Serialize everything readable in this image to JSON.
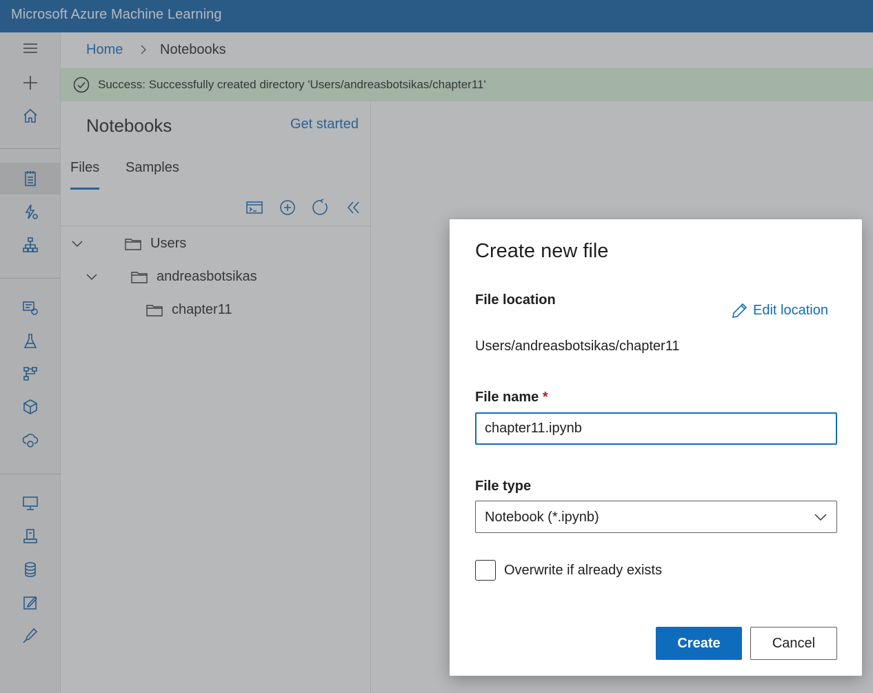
{
  "app": {
    "title": "Microsoft Azure Machine Learning"
  },
  "left_rail": {
    "items": [
      {
        "icon": "hamburger-menu-icon"
      },
      {
        "icon": "plus-icon"
      },
      {
        "icon": "home-icon"
      },
      {
        "icon": "notebook-icon",
        "active": true
      },
      {
        "icon": "automl-lightning-icon"
      },
      {
        "icon": "designer-hierarchy-icon"
      },
      {
        "icon": "datasets-icon"
      },
      {
        "icon": "experiments-flask-icon"
      },
      {
        "icon": "pipelines-icon"
      },
      {
        "icon": "models-cube-icon"
      },
      {
        "icon": "endpoints-cloud-icon"
      },
      {
        "icon": "compute-monitor-icon"
      },
      {
        "icon": "environments-icon"
      },
      {
        "icon": "datastores-cylinder-icon"
      },
      {
        "icon": "data-labeling-edit-icon"
      },
      {
        "icon": "linked-services-icon"
      }
    ]
  },
  "breadcrumb": {
    "home": "Home",
    "current": "Notebooks"
  },
  "message_bar": {
    "status": "Success:",
    "text": "Successfully created directory 'Users/andreasbotsikas/chapter11'"
  },
  "file_pane": {
    "title": "Notebooks",
    "get_started": "Get started",
    "tabs": [
      {
        "label": "Files",
        "active": true
      },
      {
        "label": "Samples",
        "active": false
      }
    ],
    "toolbar_icons": [
      "terminal-icon",
      "add-circle-icon",
      "refresh-icon",
      "collapse-double-chevron-icon"
    ],
    "tree": [
      {
        "label": "Users",
        "level": 0,
        "expanded": true
      },
      {
        "label": "andreasbotsikas",
        "level": 1,
        "expanded": true
      },
      {
        "label": "chapter11",
        "level": 2,
        "expanded": false
      }
    ]
  },
  "dialog": {
    "title": "Create new file",
    "file_location_label": "File location",
    "edit_location_label": "Edit location",
    "file_location_value": "Users/andreasbotsikas/chapter11",
    "file_name_label": "File name",
    "required_marker": "*",
    "file_name_value": "chapter11.ipynb",
    "file_type_label": "File type",
    "file_type_value": "Notebook (*.ipynb)",
    "overwrite_label": "Overwrite if already exists",
    "overwrite_checked": false,
    "create_label": "Create",
    "cancel_label": "Cancel"
  },
  "colors": {
    "brand": "#0f5fa8",
    "accent": "#0f6cbd",
    "success_bg": "#dff6dd"
  }
}
